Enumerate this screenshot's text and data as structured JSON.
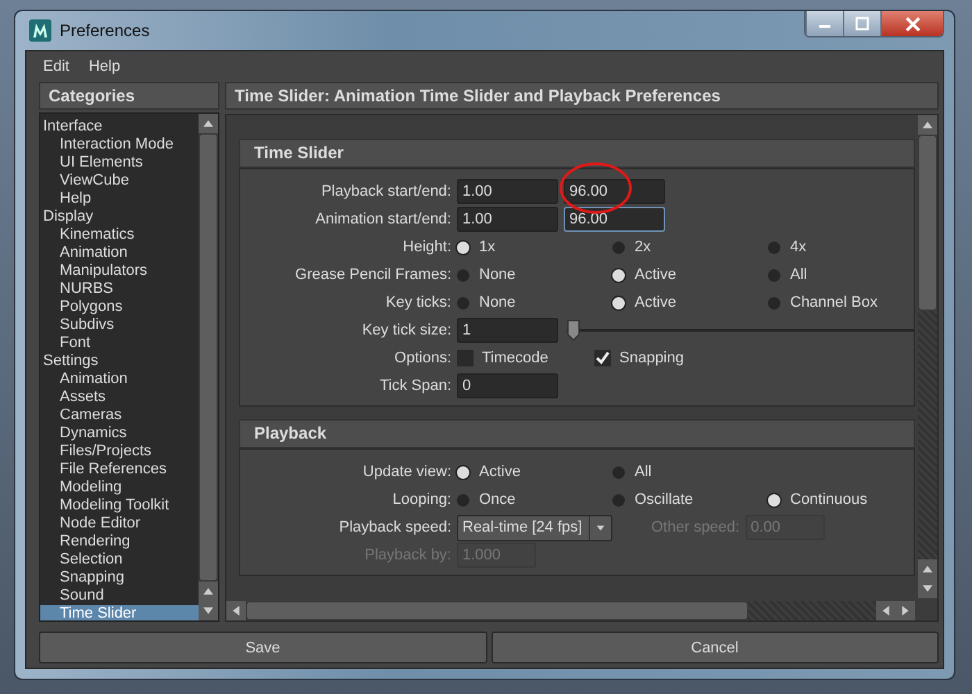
{
  "window": {
    "title": "Preferences"
  },
  "menu": [
    "Edit",
    "Help"
  ],
  "categories": {
    "title": "Categories",
    "items": [
      {
        "label": "Interface",
        "selected": false,
        "children": [
          {
            "label": "Interaction Mode",
            "selected": false
          },
          {
            "label": "UI Elements",
            "selected": false
          },
          {
            "label": "ViewCube",
            "selected": false
          },
          {
            "label": "Help",
            "selected": false
          }
        ]
      },
      {
        "label": "Display",
        "selected": false,
        "children": [
          {
            "label": "Kinematics",
            "selected": false
          },
          {
            "label": "Animation",
            "selected": false
          },
          {
            "label": "Manipulators",
            "selected": false
          },
          {
            "label": "NURBS",
            "selected": false
          },
          {
            "label": "Polygons",
            "selected": false
          },
          {
            "label": "Subdivs",
            "selected": false
          },
          {
            "label": "Font",
            "selected": false
          }
        ]
      },
      {
        "label": "Settings",
        "selected": false,
        "children": [
          {
            "label": "Animation",
            "selected": false
          },
          {
            "label": "Assets",
            "selected": false
          },
          {
            "label": "Cameras",
            "selected": false
          },
          {
            "label": "Dynamics",
            "selected": false
          },
          {
            "label": "Files/Projects",
            "selected": false
          },
          {
            "label": "File References",
            "selected": false
          },
          {
            "label": "Modeling",
            "selected": false
          },
          {
            "label": "Modeling Toolkit",
            "selected": false
          },
          {
            "label": "Node Editor",
            "selected": false
          },
          {
            "label": "Rendering",
            "selected": false
          },
          {
            "label": "Selection",
            "selected": false
          },
          {
            "label": "Snapping",
            "selected": false
          },
          {
            "label": "Sound",
            "selected": false
          },
          {
            "label": "Time Slider",
            "selected": true
          }
        ]
      }
    ]
  },
  "panel": {
    "title": "Time Slider: Animation Time Slider and Playback Preferences",
    "sections": [
      {
        "title": "Time Slider",
        "rows": [
          {
            "kind": "fields",
            "label": "Playback start/end:",
            "disabled": false,
            "fields": [
              {
                "value": "1.00",
                "focused": false
              },
              {
                "value": "96.00",
                "focused": false
              }
            ]
          },
          {
            "kind": "fields",
            "label": "Animation start/end:",
            "disabled": false,
            "fields": [
              {
                "value": "1.00",
                "focused": false
              },
              {
                "value": "96.00",
                "focused": true
              }
            ]
          },
          {
            "kind": "radios",
            "label": "Height:",
            "options": [
              {
                "label": "1x",
                "selected": true
              },
              {
                "label": "2x",
                "selected": false
              },
              {
                "label": "4x",
                "selected": false
              }
            ]
          },
          {
            "kind": "radios",
            "label": "Grease Pencil Frames:",
            "options": [
              {
                "label": "None",
                "selected": false
              },
              {
                "label": "Active",
                "selected": true
              },
              {
                "label": "All",
                "selected": false
              }
            ]
          },
          {
            "kind": "radios",
            "label": "Key ticks:",
            "options": [
              {
                "label": "None",
                "selected": false
              },
              {
                "label": "Active",
                "selected": true
              },
              {
                "label": "Channel Box",
                "selected": false
              }
            ]
          },
          {
            "kind": "slider",
            "label": "Key tick size:",
            "value": "1",
            "level": 0.0
          },
          {
            "kind": "checks",
            "label": "Options:",
            "options": [
              {
                "label": "Timecode",
                "checked": false
              },
              {
                "label": "Snapping",
                "checked": true
              }
            ]
          },
          {
            "kind": "fields",
            "label": "Tick Span:",
            "disabled": false,
            "fields": [
              {
                "value": "0",
                "focused": false
              }
            ]
          }
        ]
      },
      {
        "title": "Playback",
        "rows": [
          {
            "kind": "radios",
            "label": "Update view:",
            "options": [
              {
                "label": "Active",
                "selected": true
              },
              {
                "label": "All",
                "selected": false
              }
            ]
          },
          {
            "kind": "radios",
            "label": "Looping:",
            "options": [
              {
                "label": "Once",
                "selected": false
              },
              {
                "label": "Oscillate",
                "selected": false
              },
              {
                "label": "Continuous",
                "selected": true
              }
            ]
          },
          {
            "kind": "dropdown",
            "label": "Playback speed:",
            "value": "Real-time [24 fps]",
            "side": {
              "label": "Other speed:",
              "value": "0.00",
              "disabled": true
            }
          },
          {
            "kind": "fields",
            "label": "Playback by:",
            "disabled": true,
            "fields": [
              {
                "value": "1.000",
                "focused": false
              }
            ]
          }
        ]
      }
    ]
  },
  "buttons": [
    "Save",
    "Cancel"
  ]
}
